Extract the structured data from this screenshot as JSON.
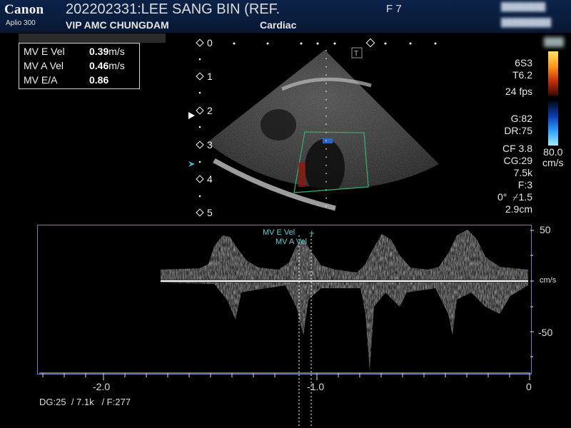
{
  "header": {
    "brand": "Canon",
    "model": "Aplio 300",
    "patient_id": "202202331:LEE SANG BIN  (REF.",
    "hospital": "VIP AMC CHUNGDAM",
    "preset": "Cardiac",
    "frame": "F 7"
  },
  "measurements": [
    {
      "label": "MV E Vel",
      "value": "0.39",
      "unit": "m/s"
    },
    {
      "label": "MV A Vel",
      "value": "0.46",
      "unit": "m/s"
    },
    {
      "label": "MV E/A",
      "value": "0.86",
      "unit": ""
    }
  ],
  "depth_scale": [
    "0",
    "1",
    "2",
    "3",
    "4",
    "5"
  ],
  "right_panel": {
    "probe": "6S3",
    "thi": "T6.2",
    "fps": "24 fps",
    "gain": "G:82",
    "dynamic_range": "DR:75",
    "cf": "CF 3.8",
    "cg": "CG:29",
    "prf": "7.5k",
    "filter": "F:3",
    "angle": "0°",
    "angle_value": "1.5",
    "depth": "2.9cm",
    "color_scale": "80.0",
    "color_unit": "cm/s"
  },
  "doppler": {
    "scale_top": "50",
    "scale_unit": "cm/s",
    "scale_bottom": "-50",
    "time_labels": [
      "-2.0",
      "-1.0",
      "0"
    ],
    "annotation_e": "MV E Vel",
    "annotation_a": "MV A Vel"
  },
  "bottom_status": {
    "dg": "DG:25",
    "prf": "/ 7.1k",
    "filter": "/ F:277"
  },
  "colors": {
    "header_bg": "#0b2247",
    "annotation": "#5fd0d6",
    "doppler_border": "#6f7fbf"
  }
}
